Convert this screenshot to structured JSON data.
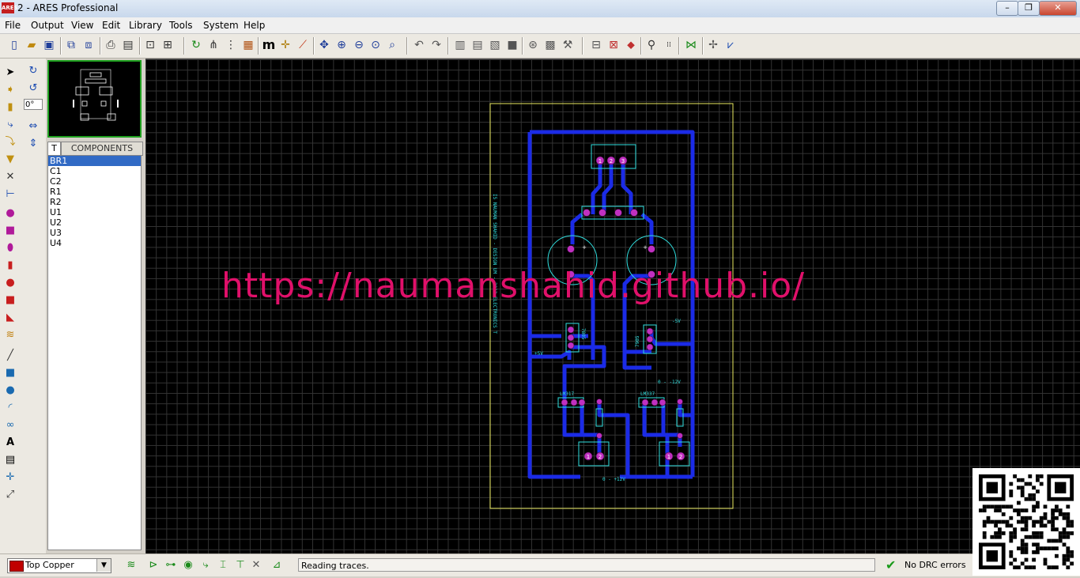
{
  "window": {
    "title": "2 - ARES Professional",
    "logo_text": "ARES",
    "min_glyph": "–",
    "max_glyph": "❐",
    "close_glyph": "✕"
  },
  "menu": [
    "File",
    "Output",
    "View",
    "Edit",
    "Library",
    "Tools",
    "System",
    "Help"
  ],
  "rotation": {
    "angle_value": "0°"
  },
  "components": {
    "tab_label": "T",
    "title": "COMPONENTS",
    "items": [
      "BR1",
      "C1",
      "C2",
      "R1",
      "R2",
      "U1",
      "U2",
      "U3",
      "U4"
    ],
    "selected_index": 0
  },
  "pcb_labels": {
    "side_text": "I5 NAUMAN SHAHID - DESIGN UM - 2013 ELECTRONICS T",
    "ref_plus5v": "+5V",
    "ref_minus5v": "-5V",
    "ic_left": "7805",
    "ic_right": "7905",
    "reg_left": "LM317",
    "reg_right": "LM337",
    "var_pos": "0 - +12V",
    "var_neg": "0 - -12V"
  },
  "watermark": "https://naumanshahid.github.io/",
  "status": {
    "layer": "Top Copper",
    "message": "Reading traces.",
    "drc": "No DRC errors"
  },
  "colors": {
    "trace": "#1b2be6",
    "pad": "#c030c0",
    "silk": "#30e0e0",
    "board_edge": "#e8e860",
    "watermark": "#e0106a"
  }
}
